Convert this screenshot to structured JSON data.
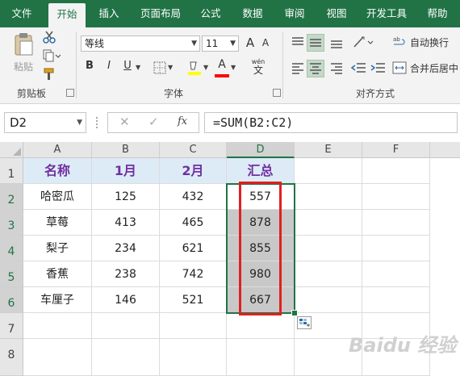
{
  "ribbon": {
    "tabs": [
      "文件",
      "开始",
      "插入",
      "页面布局",
      "公式",
      "数据",
      "审阅",
      "视图",
      "开发工具",
      "帮助"
    ],
    "active_tab": "开始",
    "clipboard": {
      "paste_label": "粘贴",
      "group_label": "剪贴板"
    },
    "font": {
      "name": "等线",
      "size": "11",
      "bold": "B",
      "italic": "I",
      "underline": "U",
      "font_color": "A",
      "grow": "A",
      "shrink": "A",
      "phonetic_top": "wén",
      "phonetic_bottom": "文",
      "group_label": "字体"
    },
    "alignment": {
      "wrap_text": "自动换行",
      "merge_center": "合并后居中",
      "group_label": "对齐方式"
    },
    "colors": {
      "accent": "#217346",
      "fill_swatch": "#ffff00",
      "font_swatch": "#ff0000"
    }
  },
  "formula_bar": {
    "name_box": "D2",
    "fx": "fx",
    "formula": "=SUM(B2:C2)"
  },
  "sheet": {
    "columns": [
      "A",
      "B",
      "C",
      "D",
      "E",
      "F"
    ],
    "selected_column": "D",
    "rows": [
      "1",
      "2",
      "3",
      "4",
      "5",
      "6",
      "7",
      "8"
    ],
    "header_row": [
      "名称",
      "1月",
      "2月",
      "汇总"
    ],
    "data": [
      [
        "哈密瓜",
        "125",
        "432",
        "557"
      ],
      [
        "草莓",
        "413",
        "465",
        "878"
      ],
      [
        "梨子",
        "234",
        "621",
        "855"
      ],
      [
        "香蕉",
        "238",
        "742",
        "980"
      ],
      [
        "车厘子",
        "146",
        "521",
        "667"
      ]
    ],
    "colors": {
      "header_fill": "#ddebf7",
      "header_text": "#7030a0",
      "selection": "#217346",
      "highlight": "#e02020"
    }
  },
  "watermark": {
    "text": "Baidu 经验"
  }
}
